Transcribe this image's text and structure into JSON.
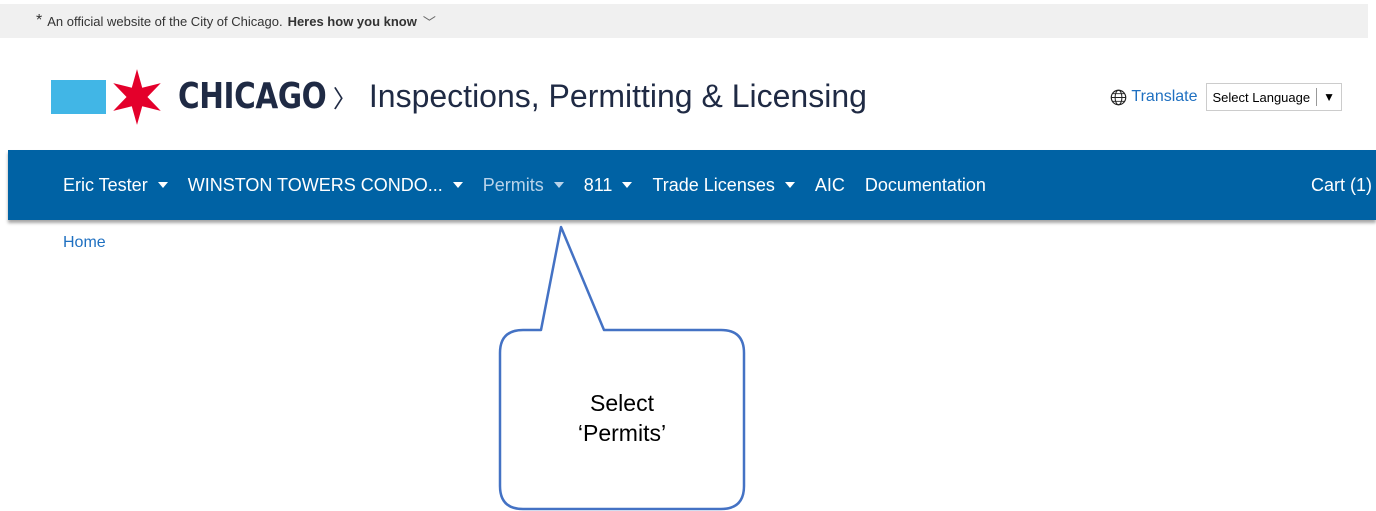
{
  "official_bar": {
    "text": "An official website of the City of Chicago.",
    "how_link": "Heres how you know"
  },
  "header": {
    "city": "CHICAGO",
    "separator": "〉",
    "app_title": "Inspections, Permitting & Licensing",
    "translate_label": "Translate",
    "language_select": "Select Language"
  },
  "nav": {
    "items": [
      {
        "label": "Eric Tester",
        "dropdown": true
      },
      {
        "label": "WINSTON TOWERS CONDO...",
        "dropdown": true
      },
      {
        "label": "Permits",
        "dropdown": true
      },
      {
        "label": "811",
        "dropdown": true
      },
      {
        "label": "Trade Licenses",
        "dropdown": true
      },
      {
        "label": "AIC",
        "dropdown": false
      },
      {
        "label": "Documentation",
        "dropdown": false
      }
    ],
    "cart": "Cart (1)"
  },
  "breadcrumb": {
    "home": "Home"
  },
  "callout": {
    "line1": "Select",
    "line2": "‘Permits’"
  },
  "colors": {
    "nav_bg": "#0062a4",
    "link": "#1f70c1",
    "chicago_blue": "#41b6e6",
    "chicago_red": "#e4002b",
    "callout_border": "#4472c4"
  }
}
